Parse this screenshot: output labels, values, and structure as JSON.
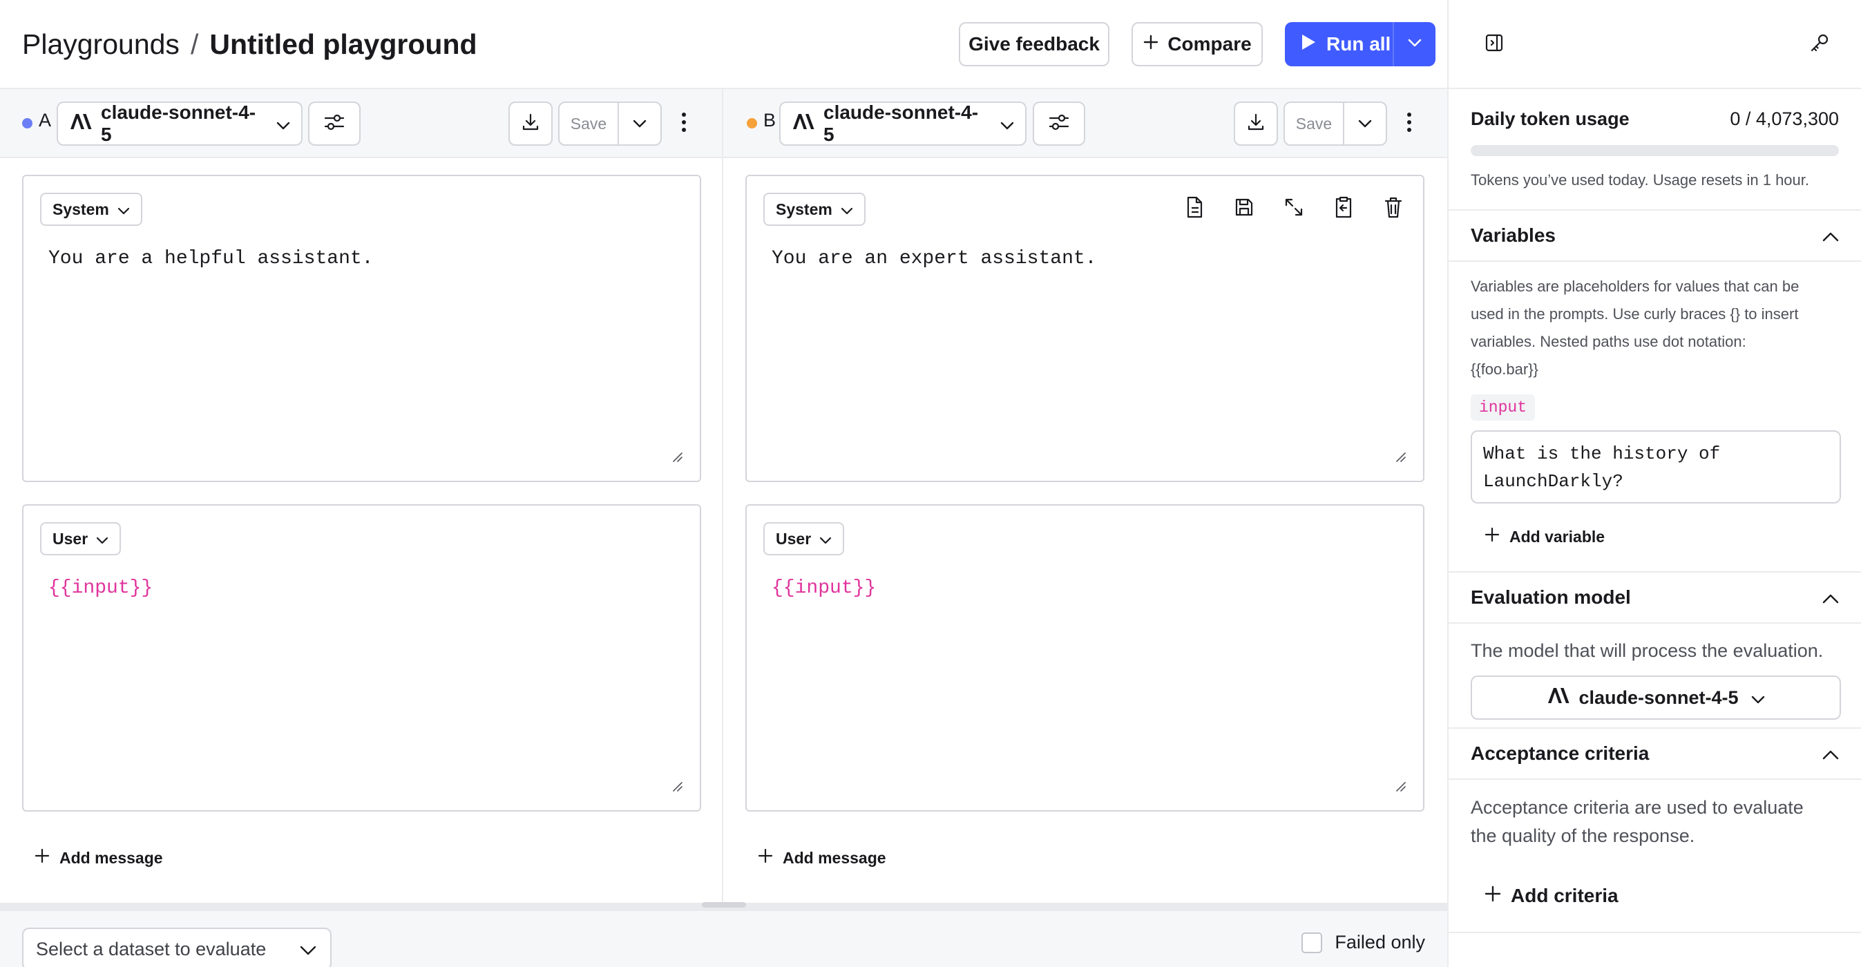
{
  "header": {
    "breadcrumb_root": "Playgrounds",
    "breadcrumb_separator": "/",
    "title": "Untitled playground",
    "feedback_label": "Give feedback",
    "compare_label": "Compare",
    "run_all_label": "Run all"
  },
  "variants": [
    {
      "letter": "A",
      "dot_color": "#6b7ef5",
      "model": "claude-sonnet-4-5",
      "save_label": "Save",
      "messages": [
        {
          "role": "System",
          "text": "You are a helpful assistant."
        },
        {
          "role": "User",
          "text": "{{input}}"
        }
      ],
      "add_message_label": "Add message"
    },
    {
      "letter": "B",
      "dot_color": "#f6a13a",
      "model": "claude-sonnet-4-5",
      "save_label": "Save",
      "messages": [
        {
          "role": "System",
          "text": "You are an expert assistant."
        },
        {
          "role": "User",
          "text": "{{input}}"
        }
      ],
      "add_message_label": "Add message"
    }
  ],
  "bottom": {
    "dataset_placeholder": "Select a dataset to evaluate",
    "failed_only_label": "Failed only",
    "failed_only_checked": false
  },
  "sidepanel": {
    "usage": {
      "title": "Daily token usage",
      "count": "0 / 4,073,300",
      "used_fraction": 0,
      "note": "Tokens you’ve used today. Usage resets in 1 hour."
    },
    "variables": {
      "title": "Variables",
      "description_lines": [
        "Variables are placeholders for values that can be",
        "used in the prompts. Use curly braces {} to insert",
        "variables. Nested paths use dot notation:",
        "{{foo.bar}}"
      ],
      "name": "input",
      "value_lines": [
        "What is the history of",
        "LaunchDarkly?"
      ],
      "add_label": "Add variable"
    },
    "evaluation": {
      "title": "Evaluation model",
      "description": "The model that will process the evaluation.",
      "model": "claude-sonnet-4-5"
    },
    "acceptance": {
      "title": "Acceptance criteria",
      "description_lines": [
        "Acceptance criteria are used to evaluate",
        "the quality of the response."
      ],
      "add_label": "Add criteria"
    }
  },
  "colors": {
    "accent": "#405bff",
    "variable_pink": "#e0339c",
    "border": "#d4d5da"
  },
  "icons": {
    "compare": "plus-icon",
    "run": "play-icon",
    "panel": "panel-collapse-icon",
    "settings": "key-icon",
    "model": "anthropic-logo-icon"
  }
}
